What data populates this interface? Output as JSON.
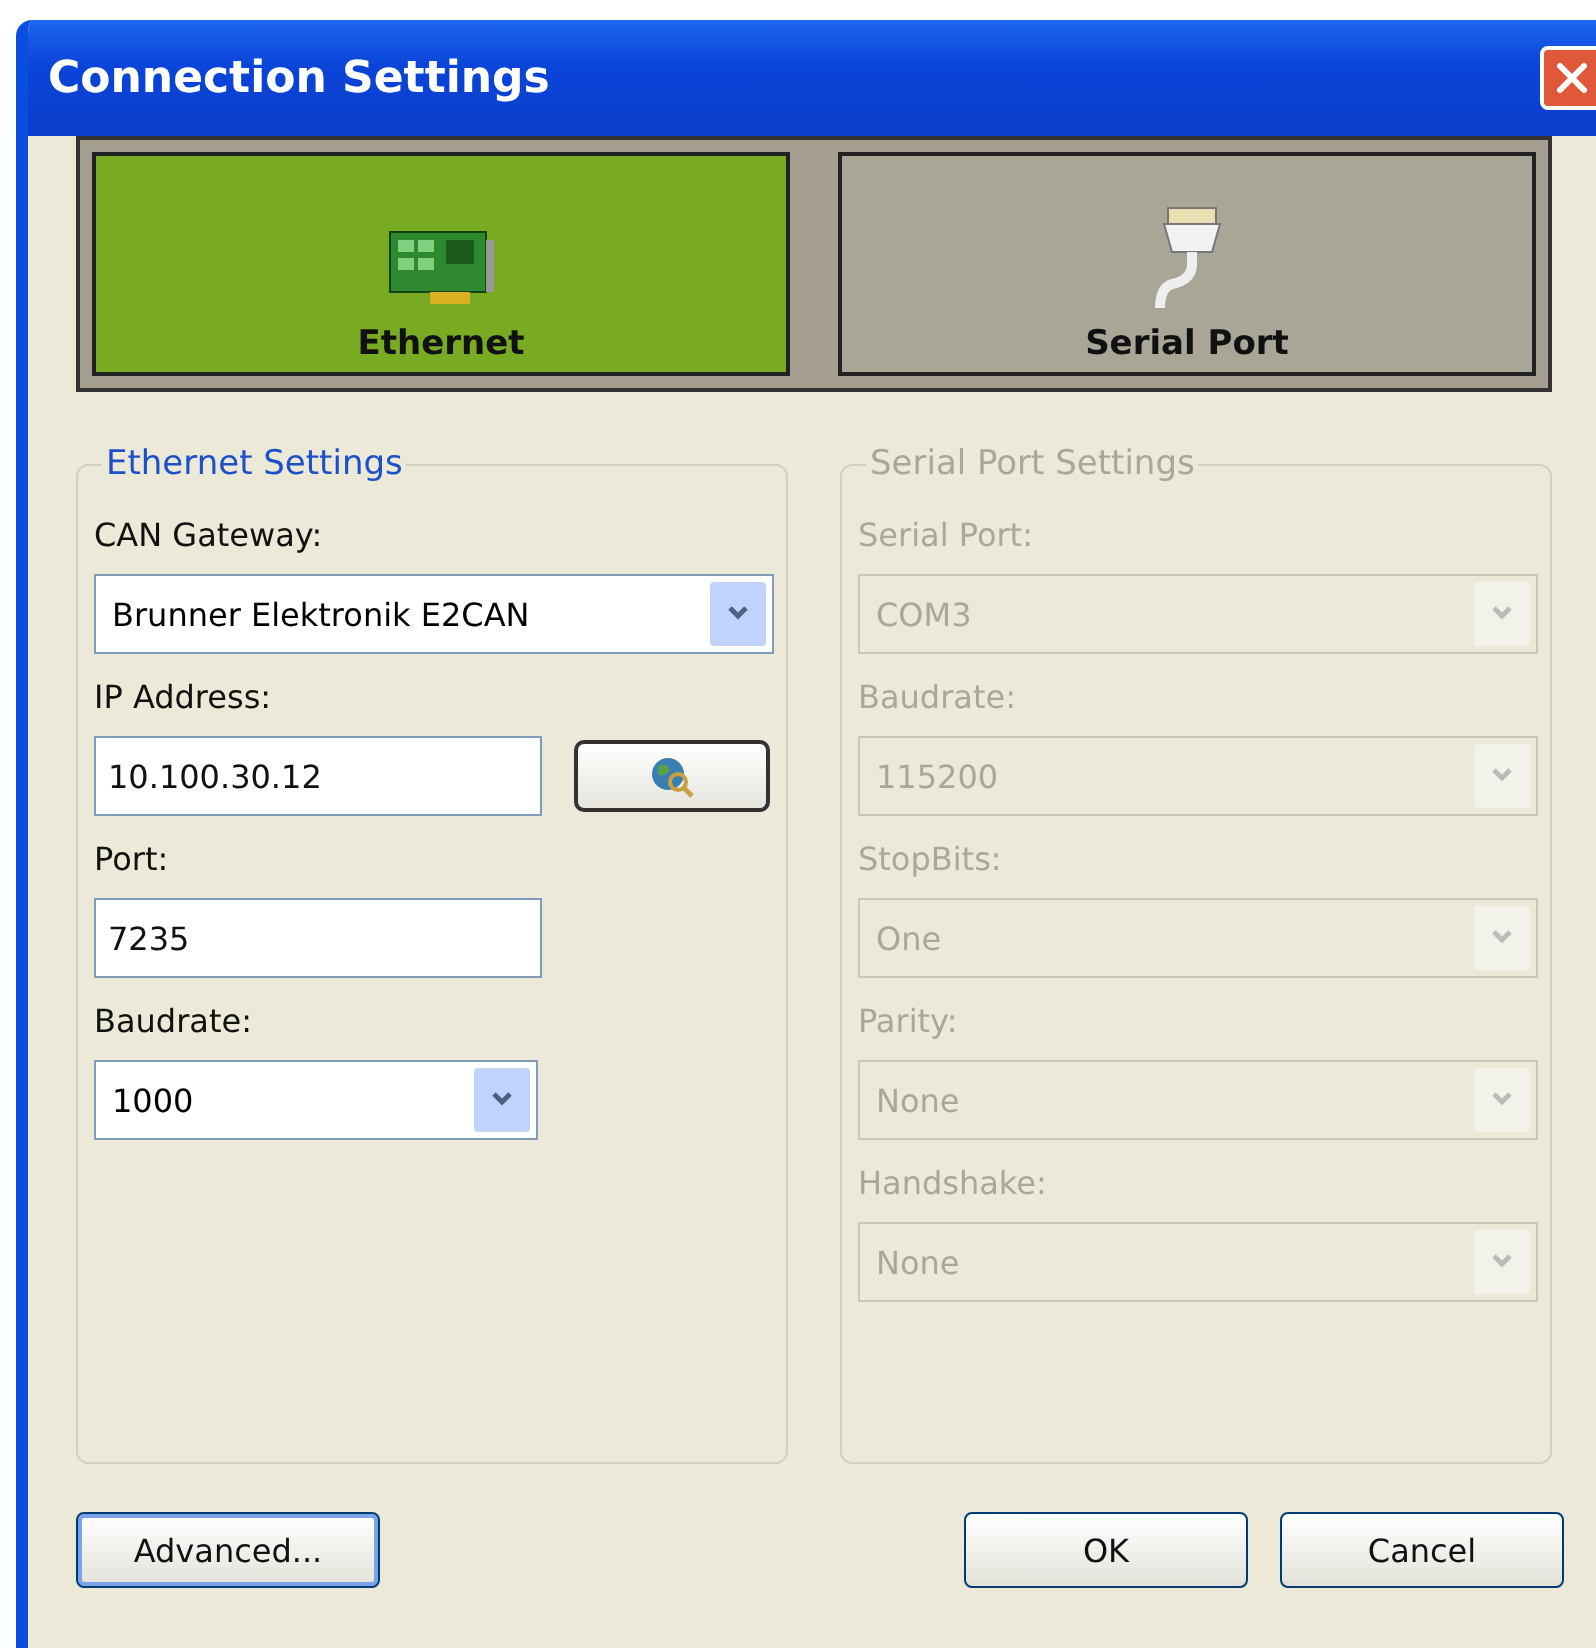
{
  "window": {
    "title": "Connection Settings"
  },
  "tabs": [
    {
      "label": "Ethernet",
      "selected": true
    },
    {
      "label": "Serial Port",
      "selected": false
    }
  ],
  "groups": [
    {
      "title": "Ethernet Settings",
      "disabled": false,
      "fields": [
        {
          "label": "CAN Gateway:",
          "kind": "dropdown",
          "value": "Brunner Elektronik E2CAN"
        },
        {
          "label": "IP Address:",
          "kind": "text-lookup",
          "value": "10.100.30.12"
        },
        {
          "label": "Port:",
          "kind": "text",
          "value": "7235"
        },
        {
          "label": "Baudrate:",
          "kind": "short-dropdown",
          "value": "1000"
        }
      ]
    },
    {
      "title": "Serial Port Settings",
      "disabled": true,
      "fields": [
        {
          "label": "Serial Port:",
          "kind": "dropdown",
          "value": "COM3"
        },
        {
          "label": "Baudrate:",
          "kind": "dropdown",
          "value": "115200"
        },
        {
          "label": "StopBits:",
          "kind": "dropdown",
          "value": "One"
        },
        {
          "label": "Parity:",
          "kind": "dropdown",
          "value": "None"
        },
        {
          "label": "Handshake:",
          "kind": "dropdown",
          "value": "None"
        }
      ]
    }
  ],
  "buttons": {
    "left": [
      {
        "label": "Advanced...",
        "default": true
      }
    ],
    "right": [
      {
        "label": "OK",
        "default": false
      },
      {
        "label": "Cancel",
        "default": false
      }
    ]
  }
}
